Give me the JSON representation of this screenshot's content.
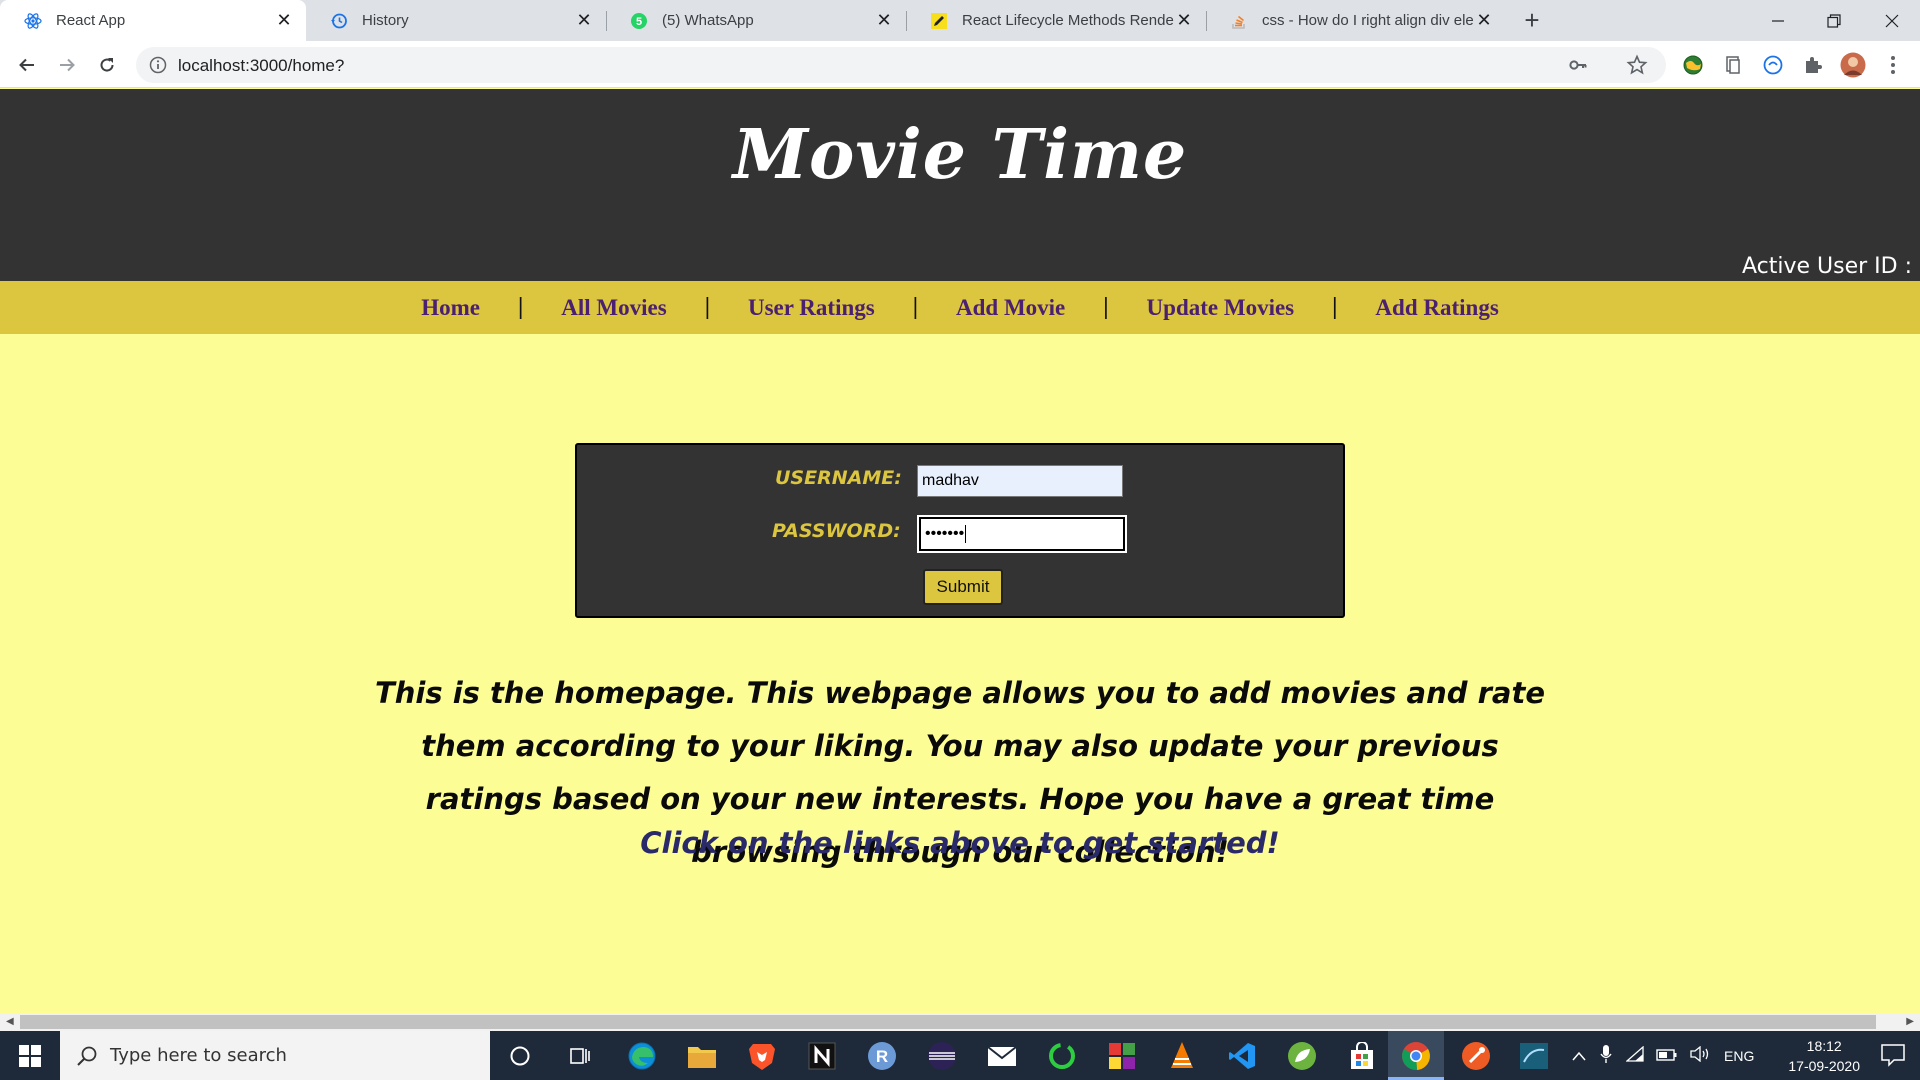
{
  "browser": {
    "tabs": [
      {
        "title": "React App",
        "icon": "react-icon",
        "active": true
      },
      {
        "title": "History",
        "icon": "history-icon",
        "active": false
      },
      {
        "title": "(5) WhatsApp",
        "icon": "whatsapp-icon",
        "active": false
      },
      {
        "title": "React Lifecycle Methods Render /",
        "icon": "pencil-icon",
        "active": false
      },
      {
        "title": "css - How do I right align div elem",
        "icon": "stackoverflow-icon",
        "active": false
      }
    ],
    "url": "localhost:3000/home?"
  },
  "site": {
    "title": "Movie Time",
    "active_user_label": "Active User ID :"
  },
  "nav": {
    "items": [
      "Home",
      "All Movies",
      "User Ratings",
      "Add Movie",
      "Update Movies",
      "Add Ratings"
    ],
    "separator": "|"
  },
  "login": {
    "username_label": "USERNAME:",
    "username_value": "madhav",
    "password_label": "PASSWORD:",
    "password_mask": "•••••••",
    "submit_label": "Submit"
  },
  "intro": {
    "text": "This is the homepage. This webpage allows you to add movies and rate them according to your liking. You may also update your previous ratings based on your new interests. Hope you have a great time browsing through our collection!",
    "cta": "Click on the links above to get started!"
  },
  "taskbar": {
    "search_placeholder": "Type here to search",
    "language": "ENG",
    "time": "18:12",
    "date": "17-09-2020"
  },
  "colors": {
    "header_bg": "#333333",
    "nav_bg": "#dcc53f",
    "page_bg": "#fdfd96",
    "nav_link": "#4b2070",
    "label_gold": "#dcc53f"
  }
}
